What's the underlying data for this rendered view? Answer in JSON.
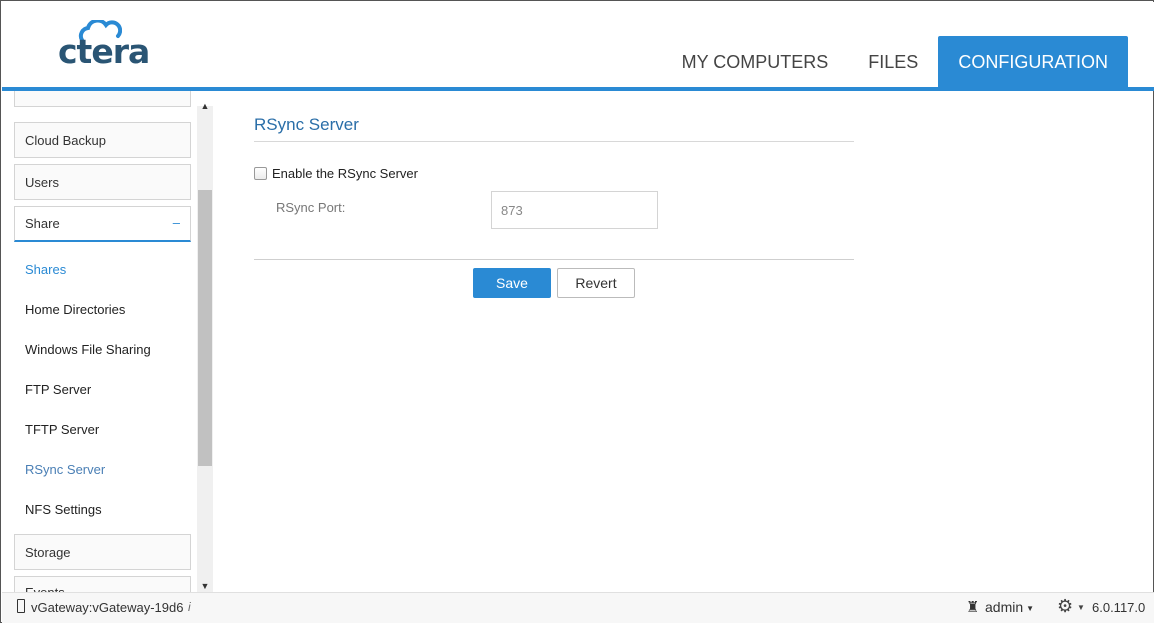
{
  "brand": {
    "logo_text": "ctera"
  },
  "nav": {
    "tabs": [
      {
        "label": "MY COMPUTERS"
      },
      {
        "label": "FILES"
      },
      {
        "label": "CONFIGURATION"
      }
    ],
    "active_tab": "CONFIGURATION"
  },
  "sidebar": {
    "boxes": {
      "cloud_backup": "Cloud Backup",
      "users": "Users",
      "share": "Share",
      "share_toggle": "–",
      "storage": "Storage",
      "partial_next": "Events"
    },
    "share_items": {
      "shares": "Shares",
      "home_directories": "Home Directories",
      "windows_file_sharing": "Windows File Sharing",
      "ftp_server": "FTP Server",
      "tftp_server": "TFTP Server",
      "rsync_server": "RSync Server",
      "nfs_settings": "NFS Settings"
    },
    "selected": "RSync Server"
  },
  "main": {
    "title": "RSync Server",
    "enable_label": "Enable the RSync Server",
    "enable_checked": false,
    "port_label": "RSync Port:",
    "port_value": "873",
    "save_label": "Save",
    "revert_label": "Revert"
  },
  "footer": {
    "device_name": "vGateway:vGateway-19d6",
    "info_symbol": "i",
    "user": "admin",
    "version": "6.0.117.0"
  },
  "colors": {
    "accent": "#2a8ad4",
    "logo": "#2a5574",
    "title": "#2a6ea8"
  }
}
